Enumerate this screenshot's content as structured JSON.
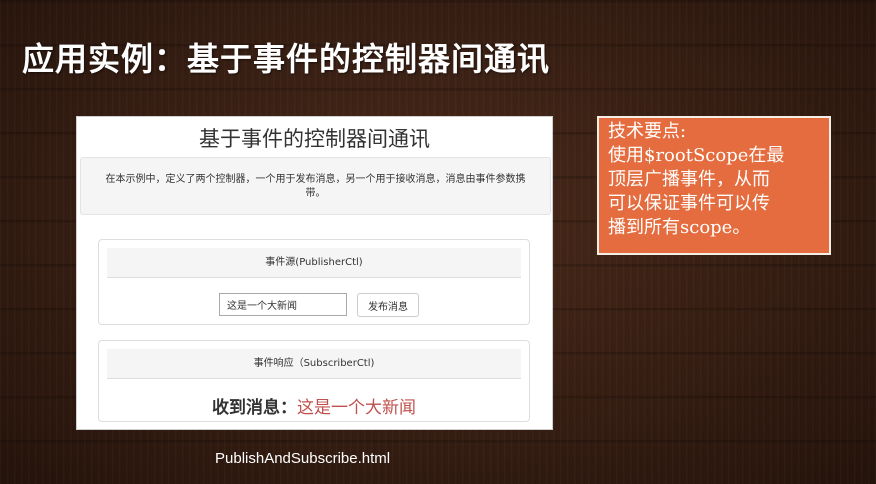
{
  "slide": {
    "title": "应用实例：基于事件的控制器间通讯",
    "filename": "PublishAndSubscribe.html"
  },
  "demo": {
    "heading": "基于事件的控制器间通讯",
    "intro": "在本示例中，定义了两个控制器，一个用于发布消息，另一个用于接收消息，消息由事件参数携带。",
    "publisher": {
      "heading": "事件源(PublisherCtl)",
      "input_value": "这是一个大新闻",
      "button_label": "发布消息"
    },
    "subscriber": {
      "heading": "事件响应（SubscriberCtl)",
      "received_label": "收到消息：",
      "received_value": "这是一个大新闻"
    }
  },
  "tip": {
    "title": "技术要点:",
    "body": "使用$rootScope在最\n顶层广播事件，从而\n可以保证事件可以传\n播到所有scope。"
  },
  "colors": {
    "tip_background": "#e46c3f",
    "received_value": "#c0504d",
    "background": "#3a2014"
  }
}
